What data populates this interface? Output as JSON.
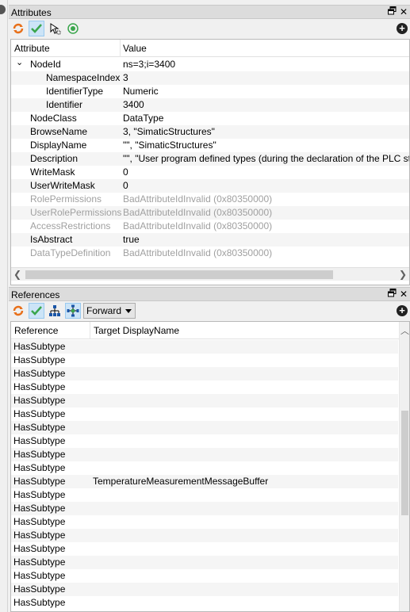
{
  "attributes_panel": {
    "title": "Attributes",
    "columns": {
      "attribute": "Attribute",
      "value": "Value"
    },
    "rows": [
      {
        "name": "NodeId",
        "value": "ns=3;i=3400",
        "level": 0,
        "expanded": true,
        "disabled": false
      },
      {
        "name": "NamespaceIndex",
        "value": "3",
        "level": 1,
        "disabled": false
      },
      {
        "name": "IdentifierType",
        "value": "Numeric",
        "level": 1,
        "disabled": false
      },
      {
        "name": "Identifier",
        "value": "3400",
        "level": 1,
        "disabled": false
      },
      {
        "name": "NodeClass",
        "value": "DataType",
        "level": 0,
        "disabled": false
      },
      {
        "name": "BrowseName",
        "value": "3, \"SimaticStructures\"",
        "level": 0,
        "disabled": false
      },
      {
        "name": "DisplayName",
        "value": "\"\", \"SimaticStructures\"",
        "level": 0,
        "disabled": false
      },
      {
        "name": "Description",
        "value": "\"\", \"User program defined types (during the declaration of the PLC stru",
        "level": 0,
        "disabled": false
      },
      {
        "name": "WriteMask",
        "value": "0",
        "level": 0,
        "disabled": false
      },
      {
        "name": "UserWriteMask",
        "value": "0",
        "level": 0,
        "disabled": false
      },
      {
        "name": "RolePermissions",
        "value": "BadAttributeIdInvalid (0x80350000)",
        "level": 0,
        "disabled": true
      },
      {
        "name": "UserRolePermissions",
        "value": "BadAttributeIdInvalid (0x80350000)",
        "level": 0,
        "disabled": true
      },
      {
        "name": "AccessRestrictions",
        "value": "BadAttributeIdInvalid (0x80350000)",
        "level": 0,
        "disabled": true
      },
      {
        "name": "IsAbstract",
        "value": "true",
        "level": 0,
        "disabled": false
      },
      {
        "name": "DataTypeDefinition",
        "value": "BadAttributeIdInvalid (0x80350000)",
        "level": 0,
        "disabled": true
      }
    ]
  },
  "references_panel": {
    "title": "References",
    "direction": "Forward",
    "columns": {
      "reference": "Reference",
      "target": "Target DisplayName"
    },
    "rows": [
      {
        "reference": "HasSubtype",
        "target": ""
      },
      {
        "reference": "HasSubtype",
        "target": ""
      },
      {
        "reference": "HasSubtype",
        "target": ""
      },
      {
        "reference": "HasSubtype",
        "target": ""
      },
      {
        "reference": "HasSubtype",
        "target": ""
      },
      {
        "reference": "HasSubtype",
        "target": ""
      },
      {
        "reference": "HasSubtype",
        "target": ""
      },
      {
        "reference": "HasSubtype",
        "target": ""
      },
      {
        "reference": "HasSubtype",
        "target": ""
      },
      {
        "reference": "HasSubtype",
        "target": ""
      },
      {
        "reference": "HasSubtype",
        "target": "TemperatureMeasurementMessageBuffer"
      },
      {
        "reference": "HasSubtype",
        "target": ""
      },
      {
        "reference": "HasSubtype",
        "target": ""
      },
      {
        "reference": "HasSubtype",
        "target": ""
      },
      {
        "reference": "HasSubtype",
        "target": ""
      },
      {
        "reference": "HasSubtype",
        "target": ""
      },
      {
        "reference": "HasSubtype",
        "target": ""
      },
      {
        "reference": "HasSubtype",
        "target": ""
      },
      {
        "reference": "HasSubtype",
        "target": ""
      },
      {
        "reference": "HasSubtype",
        "target": ""
      }
    ]
  },
  "icons": {
    "refresh": "refresh-icon",
    "check": "checkmark-icon",
    "select": "pointer-select-icon",
    "target": "target-icon",
    "hierarchy": "hierarchy-icon",
    "network": "network-icon",
    "float": "float-window-icon",
    "close": "close-icon",
    "add": "add-icon"
  },
  "colors": {
    "accent_orange": "#e8701a",
    "accent_green": "#3aa64c",
    "selected_button": "#cce4f7",
    "disabled_text": "#a0a0a0"
  }
}
